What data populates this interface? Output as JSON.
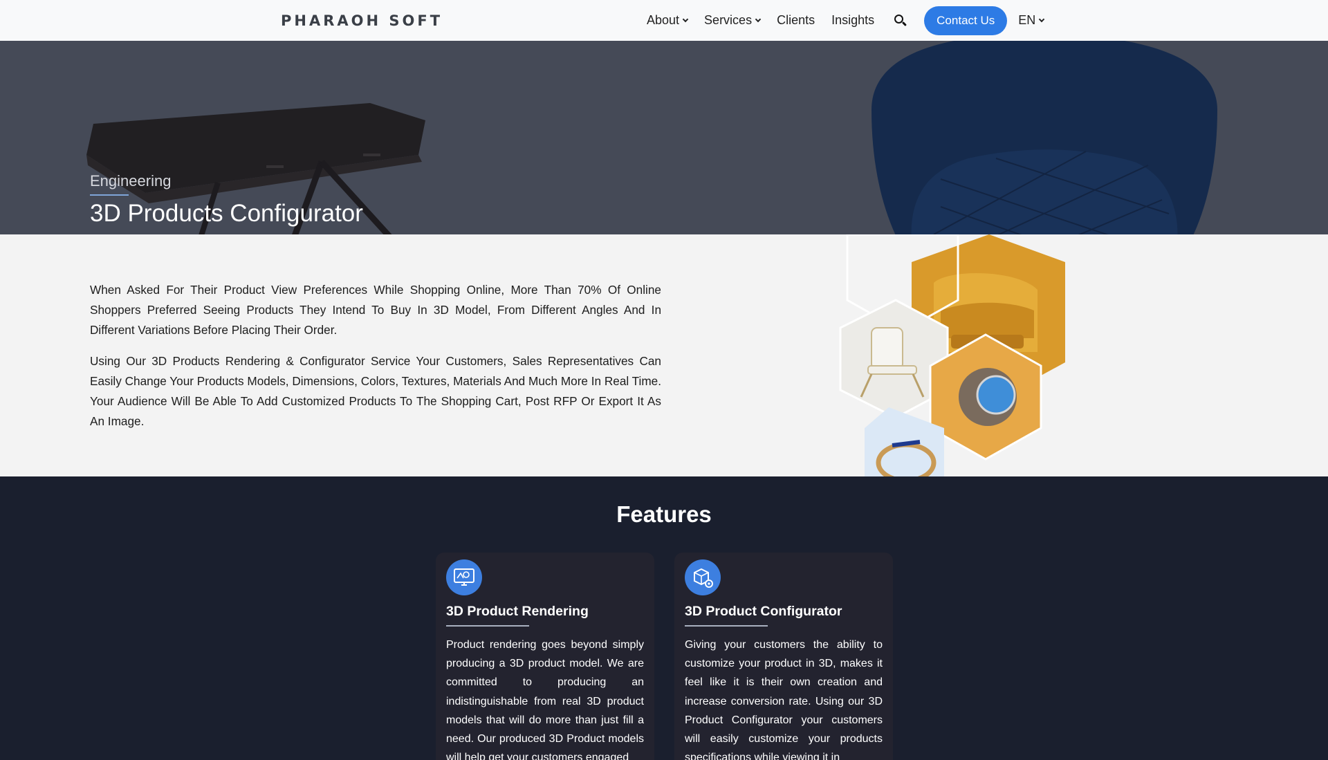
{
  "header": {
    "logo_text": "PHARAOH SOFT",
    "nav": {
      "about": "About",
      "services": "Services",
      "clients": "Clients",
      "insights": "Insights"
    },
    "contact_label": "Contact Us",
    "language": "EN",
    "accent_color": "#2d7be5"
  },
  "hero": {
    "subtitle": "Engineering",
    "title": "3D Products Configurator"
  },
  "intro": {
    "paragraphs": [
      "When Asked For Their Product View Preferences While Shopping Online, More Than 70% Of Online Shoppers Preferred Seeing Products They Intend To Buy In 3D Model, From Different Angles And In Different Variations Before Placing Their Order.",
      "Using Our 3D Products Rendering & Configurator Service Your Customers, Sales Representatives Can Easily Change Your Products Models, Dimensions, Colors, Textures, Materials And Much More In Real Time. Your Audience Will Be Able To Add Customized Products To The Shopping Cart, Post RFP Or Export It As An Image."
    ]
  },
  "features": {
    "title": "Features",
    "cards": [
      {
        "icon": "monitor-render-icon",
        "title": "3D Product Rendering",
        "text": "Product rendering goes beyond simply producing a 3D product model. We are committed to producing an indistinguishable from real 3D product models that will do more than just fill a need. Our produced 3D Product models will help get your customers engaged"
      },
      {
        "icon": "cube-gear-icon",
        "title": "3D Product Configurator",
        "text": "Giving your customers the ability to customize your product in 3D, makes it feel like it is their own creation and increase conversion rate. Using our 3D Product Configurator your customers will easily customize your products specifications while viewing it in"
      }
    ]
  }
}
